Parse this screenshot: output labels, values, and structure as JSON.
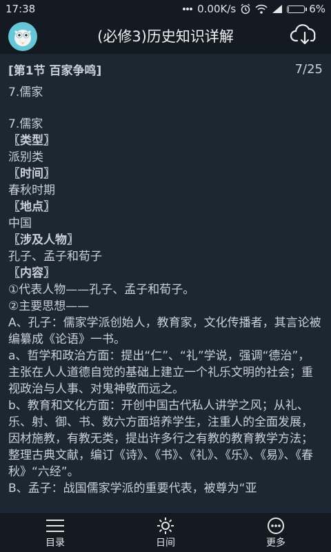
{
  "status_bar": {
    "time": "17:38",
    "network_speed": "0.00K/s",
    "battery_percent": "6%",
    "battery_level": 0.06,
    "icons": [
      "dots-icon",
      "alarm-icon",
      "wifi-icon",
      "signal-icon",
      "battery-icon"
    ]
  },
  "header": {
    "title": "(必修3)历史知识详解",
    "logo_icon": "owl-logo-icon",
    "action_icon": "cloud-download-icon",
    "accent_color": "#64c8d8"
  },
  "section": {
    "title": "[第1节 百家争鸣]",
    "counter": "7/25"
  },
  "topic": "7.儒家",
  "article": {
    "lines": [
      {
        "text": "7.儒家",
        "bold": false
      },
      {
        "text": "〖类型〗",
        "bold": true
      },
      {
        "text": "派别类",
        "bold": false
      },
      {
        "text": "〖时间〗",
        "bold": true
      },
      {
        "text": "春秋时期",
        "bold": false
      },
      {
        "text": "〖地点〗",
        "bold": true
      },
      {
        "text": "中国",
        "bold": false
      },
      {
        "text": "〖涉及人物〗",
        "bold": true
      },
      {
        "text": "孔子、孟子和荀子",
        "bold": false
      },
      {
        "text": "〖内容〗",
        "bold": true
      },
      {
        "text": "①代表人物——孔子、孟子和荀子。",
        "bold": false
      },
      {
        "text": "②主要思想——",
        "bold": false
      },
      {
        "text": "A、孔子：儒家学派创始人，教育家，文化传播者，其言论被编纂成《论语》一书。",
        "bold": false
      },
      {
        "text": "a、哲学和政治方面：提出“仁”、“礼”学说，强调“德治”， 主张在人人道德自觉的基础上建立一个礼乐文明的社会；重视政治与人事、对鬼神敬而远之。",
        "bold": false
      },
      {
        "text": "b、教育和文化方面：开创中国古代私人讲学之风；从礼、乐、射、御、书、数六方面培养学生，注重人的全面发展，因材施教，有教无类，提出许多行之有教的教育教学方法；整理古典文献，编订《诗》、《书》、《礼》、《乐》、《易》、《春秋》“六经”。",
        "bold": false
      },
      {
        "text": "B、孟子：战国儒家学派的重要代表，被尊为“亚",
        "bold": false
      }
    ]
  },
  "bottom_nav": [
    {
      "label": "目录",
      "icon": "list-icon"
    },
    {
      "label": "日间",
      "icon": "sun-icon"
    },
    {
      "label": "更多",
      "icon": "more-icon"
    }
  ]
}
